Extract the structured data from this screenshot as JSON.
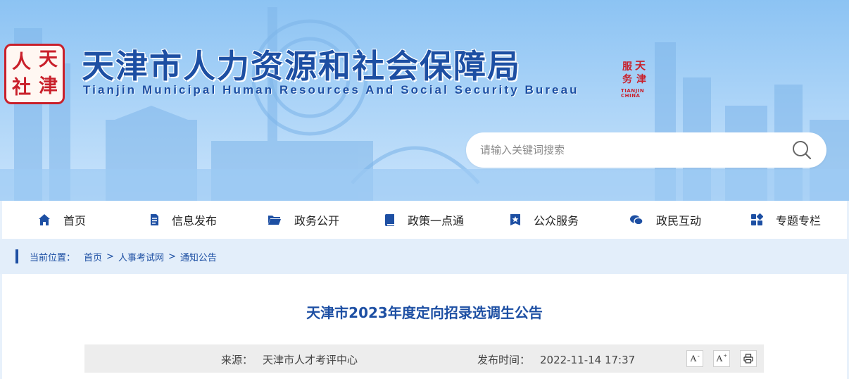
{
  "header": {
    "seal_chars": [
      "人",
      "天",
      "社",
      "津"
    ],
    "title": "天津市人力资源和社会保障局",
    "subtitle": "Tianjin Municipal Human Resources And Social Security Bureau",
    "mini_seal_chars": [
      "天",
      "津",
      "服",
      "务"
    ],
    "mini_seal_text": "TIANJIN CHINA",
    "search": {
      "placeholder": "请输入关键词搜索",
      "icon": "search-icon"
    }
  },
  "nav": {
    "items": [
      {
        "label": "首页",
        "icon": "home-icon"
      },
      {
        "label": "信息发布",
        "icon": "document-icon"
      },
      {
        "label": "政务公开",
        "icon": "folder-icon"
      },
      {
        "label": "政策一点通",
        "icon": "book-icon"
      },
      {
        "label": "公众服务",
        "icon": "star-badge-icon"
      },
      {
        "label": "政民互动",
        "icon": "chat-icon"
      },
      {
        "label": "专题专栏",
        "icon": "grid-icon"
      }
    ]
  },
  "breadcrumb": {
    "label": "当前位置：",
    "items": [
      "首页",
      "人事考试网",
      "通知公告"
    ],
    "separator": ">"
  },
  "article": {
    "title": "天津市2023年度定向招录选调生公告",
    "source_label": "来源：",
    "source_value": "天津市人才考评中心",
    "time_label": "发布时间：",
    "time_value": "2022-11-14 17:37",
    "tools": {
      "font_smaller": "A",
      "font_smaller_sign": "-",
      "font_larger": "A",
      "font_larger_sign": "+",
      "print_icon": "print-icon"
    }
  },
  "colors": {
    "brand_blue": "#1d4fa3",
    "seal_red": "#c9202b",
    "sky": "#8cc3f3"
  }
}
